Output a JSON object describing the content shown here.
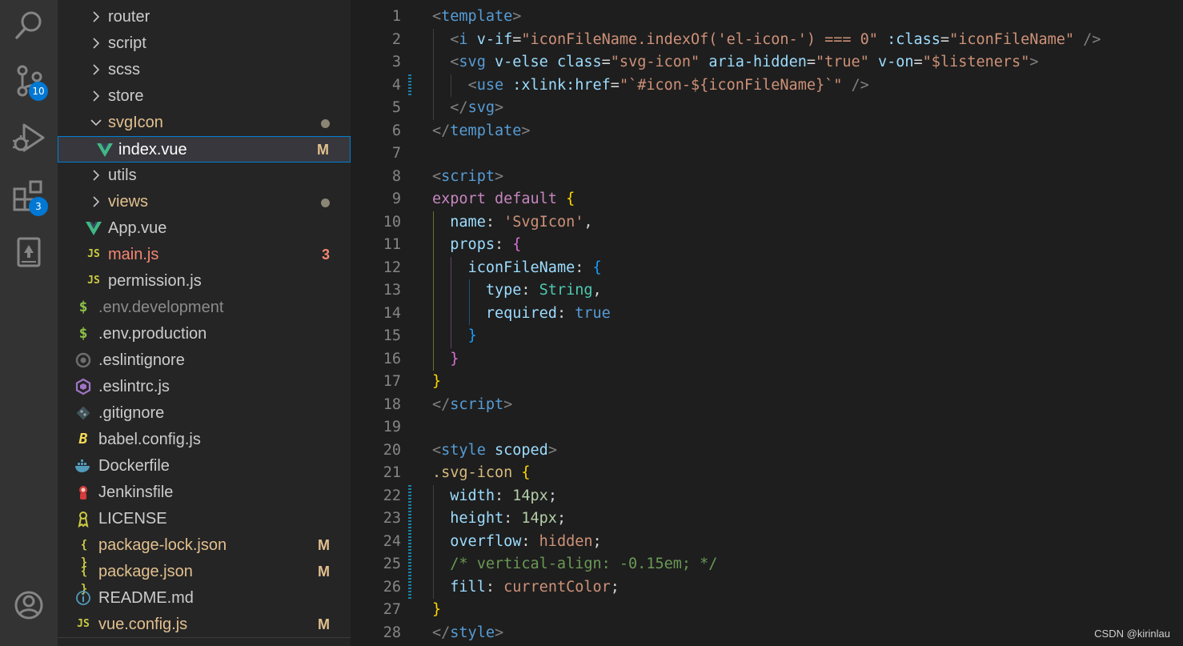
{
  "activity_bar": {
    "source_control_badge": "10",
    "extensions_badge": "3"
  },
  "explorer": {
    "items": [
      {
        "label": "router",
        "kind": "folder",
        "icon": "chevron-right-icon"
      },
      {
        "label": "script",
        "kind": "folder",
        "icon": "chevron-right-icon"
      },
      {
        "label": "scss",
        "kind": "folder",
        "icon": "chevron-right-icon"
      },
      {
        "label": "store",
        "kind": "folder",
        "icon": "chevron-right-icon"
      },
      {
        "label": "svgIcon",
        "kind": "folder-open",
        "icon": "chevron-down-icon",
        "decoration": "dot"
      },
      {
        "label": "index.vue",
        "kind": "vue",
        "icon": "vue-icon",
        "decoration": "M",
        "selected": true
      },
      {
        "label": "utils",
        "kind": "folder",
        "icon": "chevron-right-icon"
      },
      {
        "label": "views",
        "kind": "folder",
        "icon": "chevron-right-icon",
        "decoration": "dot"
      },
      {
        "label": "App.vue",
        "kind": "vue",
        "icon": "vue-icon"
      },
      {
        "label": "main.js",
        "kind": "js",
        "icon": "js-icon",
        "decoration": "3",
        "error": true
      },
      {
        "label": "permission.js",
        "kind": "js",
        "icon": "js-icon"
      },
      {
        "label": ".env.development",
        "kind": "env",
        "icon": "dollar-icon",
        "dim": true
      },
      {
        "label": ".env.production",
        "kind": "env",
        "icon": "dollar-icon"
      },
      {
        "label": ".eslintignore",
        "kind": "eslintignore",
        "icon": "eslint-ignore-icon"
      },
      {
        "label": ".eslintrc.js",
        "kind": "eslint",
        "icon": "eslint-icon"
      },
      {
        "label": ".gitignore",
        "kind": "git",
        "icon": "git-icon"
      },
      {
        "label": "babel.config.js",
        "kind": "babel",
        "icon": "babel-icon"
      },
      {
        "label": "Dockerfile",
        "kind": "docker",
        "icon": "docker-icon"
      },
      {
        "label": "Jenkinsfile",
        "kind": "jenkins",
        "icon": "jenkins-icon"
      },
      {
        "label": "LICENSE",
        "kind": "license",
        "icon": "license-icon"
      },
      {
        "label": "package-lock.json",
        "kind": "json",
        "icon": "json-icon",
        "decoration": "M",
        "modified": true
      },
      {
        "label": "package.json",
        "kind": "json",
        "icon": "json-icon",
        "decoration": "M",
        "modified": true
      },
      {
        "label": "README.md",
        "kind": "info",
        "icon": "info-icon"
      },
      {
        "label": "vue.config.js",
        "kind": "js",
        "icon": "js-icon",
        "decoration": "M",
        "modified": true
      }
    ],
    "glyphs": {
      "js": "JS",
      "env": "$",
      "json": "{ }",
      "babel": "B",
      "info": "i"
    }
  },
  "editor": {
    "lines": [
      {
        "n": "1",
        "tokens": [
          [
            "<",
            "t-punc"
          ],
          [
            "template",
            "t-tag"
          ],
          [
            ">",
            "t-punc"
          ]
        ]
      },
      {
        "n": "2",
        "tokens": [
          [
            "  ",
            "t-default"
          ],
          [
            "<",
            "t-punc"
          ],
          [
            "i",
            "t-tag"
          ],
          [
            " ",
            "t-default"
          ],
          [
            "v-if",
            "t-attr"
          ],
          [
            "=",
            "t-default"
          ],
          [
            "\"iconFileName.indexOf(",
            "t-str"
          ],
          [
            "'el-icon-'",
            "t-str"
          ],
          [
            ") === 0\"",
            "t-str"
          ],
          [
            " ",
            "t-default"
          ],
          [
            ":class",
            "t-attr"
          ],
          [
            "=",
            "t-default"
          ],
          [
            "\"iconFileName\"",
            "t-str"
          ],
          [
            " ",
            "t-default"
          ],
          [
            "/>",
            "t-punc"
          ]
        ]
      },
      {
        "n": "3",
        "tokens": [
          [
            "  ",
            "t-default"
          ],
          [
            "<",
            "t-punc"
          ],
          [
            "svg",
            "t-tag"
          ],
          [
            " ",
            "t-default"
          ],
          [
            "v-else",
            "t-attr"
          ],
          [
            " ",
            "t-default"
          ],
          [
            "class",
            "t-attr"
          ],
          [
            "=",
            "t-default"
          ],
          [
            "\"svg-icon\"",
            "t-str"
          ],
          [
            " ",
            "t-default"
          ],
          [
            "aria-hidden",
            "t-attr"
          ],
          [
            "=",
            "t-default"
          ],
          [
            "\"true\"",
            "t-str"
          ],
          [
            " ",
            "t-default"
          ],
          [
            "v-on",
            "t-attr"
          ],
          [
            "=",
            "t-default"
          ],
          [
            "\"$listeners\"",
            "t-str"
          ],
          [
            ">",
            "t-punc"
          ]
        ]
      },
      {
        "n": "4",
        "tokens": [
          [
            "    ",
            "t-default"
          ],
          [
            "<",
            "t-punc"
          ],
          [
            "use",
            "t-tag"
          ],
          [
            " ",
            "t-default"
          ],
          [
            ":xlink:href",
            "t-attr"
          ],
          [
            "=",
            "t-default"
          ],
          [
            "\"`#icon-${iconFileName}`\"",
            "t-str"
          ],
          [
            " ",
            "t-default"
          ],
          [
            "/>",
            "t-punc"
          ]
        ]
      },
      {
        "n": "5",
        "tokens": [
          [
            "  ",
            "t-default"
          ],
          [
            "</",
            "t-punc"
          ],
          [
            "svg",
            "t-tag"
          ],
          [
            ">",
            "t-punc"
          ]
        ]
      },
      {
        "n": "6",
        "tokens": [
          [
            "</",
            "t-punc"
          ],
          [
            "template",
            "t-tag"
          ],
          [
            ">",
            "t-punc"
          ]
        ]
      },
      {
        "n": "7",
        "tokens": []
      },
      {
        "n": "8",
        "tokens": [
          [
            "<",
            "t-punc"
          ],
          [
            "script",
            "t-tag"
          ],
          [
            ">",
            "t-punc"
          ]
        ]
      },
      {
        "n": "9",
        "tokens": [
          [
            "export",
            "t-kw"
          ],
          [
            " ",
            "t-default"
          ],
          [
            "default",
            "t-kw"
          ],
          [
            " ",
            "t-default"
          ],
          [
            "{",
            "t-b1"
          ]
        ]
      },
      {
        "n": "10",
        "tokens": [
          [
            "  ",
            "t-default"
          ],
          [
            "name",
            "t-prop"
          ],
          [
            ": ",
            "t-default"
          ],
          [
            "'SvgIcon'",
            "t-str"
          ],
          [
            ",",
            "t-default"
          ]
        ]
      },
      {
        "n": "11",
        "tokens": [
          [
            "  ",
            "t-default"
          ],
          [
            "props",
            "t-prop"
          ],
          [
            ": ",
            "t-default"
          ],
          [
            "{",
            "t-b2"
          ]
        ]
      },
      {
        "n": "12",
        "tokens": [
          [
            "    ",
            "t-default"
          ],
          [
            "iconFileName",
            "t-prop"
          ],
          [
            ": ",
            "t-default"
          ],
          [
            "{",
            "t-b3"
          ]
        ]
      },
      {
        "n": "13",
        "tokens": [
          [
            "      ",
            "t-default"
          ],
          [
            "type",
            "t-prop"
          ],
          [
            ": ",
            "t-default"
          ],
          [
            "String",
            "t-type"
          ],
          [
            ",",
            "t-default"
          ]
        ]
      },
      {
        "n": "14",
        "tokens": [
          [
            "      ",
            "t-default"
          ],
          [
            "required",
            "t-prop"
          ],
          [
            ": ",
            "t-default"
          ],
          [
            "true",
            "t-bool"
          ]
        ]
      },
      {
        "n": "15",
        "tokens": [
          [
            "    ",
            "t-default"
          ],
          [
            "}",
            "t-b3"
          ]
        ]
      },
      {
        "n": "16",
        "tokens": [
          [
            "  ",
            "t-default"
          ],
          [
            "}",
            "t-b2"
          ]
        ]
      },
      {
        "n": "17",
        "tokens": [
          [
            "}",
            "t-b1"
          ]
        ]
      },
      {
        "n": "18",
        "tokens": [
          [
            "</",
            "t-punc"
          ],
          [
            "script",
            "t-tag"
          ],
          [
            ">",
            "t-punc"
          ]
        ]
      },
      {
        "n": "19",
        "tokens": []
      },
      {
        "n": "20",
        "tokens": [
          [
            "<",
            "t-punc"
          ],
          [
            "style",
            "t-tag"
          ],
          [
            " ",
            "t-default"
          ],
          [
            "scoped",
            "t-attr"
          ],
          [
            ">",
            "t-punc"
          ]
        ]
      },
      {
        "n": "21",
        "tokens": [
          [
            ".svg-icon",
            "t-cls"
          ],
          [
            " ",
            "t-default"
          ],
          [
            "{",
            "t-b1"
          ]
        ]
      },
      {
        "n": "22",
        "tokens": [
          [
            "  ",
            "t-default"
          ],
          [
            "width",
            "t-prop"
          ],
          [
            ": ",
            "t-default"
          ],
          [
            "14px",
            "t-num"
          ],
          [
            ";",
            "t-default"
          ]
        ]
      },
      {
        "n": "23",
        "tokens": [
          [
            "  ",
            "t-default"
          ],
          [
            "height",
            "t-prop"
          ],
          [
            ": ",
            "t-default"
          ],
          [
            "14px",
            "t-num"
          ],
          [
            ";",
            "t-default"
          ]
        ]
      },
      {
        "n": "24",
        "tokens": [
          [
            "  ",
            "t-default"
          ],
          [
            "overflow",
            "t-prop"
          ],
          [
            ": ",
            "t-default"
          ],
          [
            "hidden",
            "t-str"
          ],
          [
            ";",
            "t-default"
          ]
        ]
      },
      {
        "n": "25",
        "tokens": [
          [
            "  ",
            "t-default"
          ],
          [
            "/* vertical-align: -0.15em; */",
            "t-com"
          ]
        ]
      },
      {
        "n": "26",
        "tokens": [
          [
            "  ",
            "t-default"
          ],
          [
            "fill",
            "t-prop"
          ],
          [
            ": ",
            "t-default"
          ],
          [
            "currentColor",
            "t-str"
          ],
          [
            ";",
            "t-default"
          ]
        ]
      },
      {
        "n": "27",
        "tokens": [
          [
            "}",
            "t-b1"
          ]
        ]
      },
      {
        "n": "28",
        "tokens": [
          [
            "</",
            "t-punc"
          ],
          [
            "style",
            "t-tag"
          ],
          [
            ">",
            "t-punc"
          ]
        ]
      }
    ],
    "modified_lines": [
      "4",
      "22",
      "23",
      "24",
      "25",
      "26"
    ]
  },
  "watermark": "CSDN @kirinlau",
  "colors": {
    "activity_bar": "#333333",
    "sidebar": "#252526",
    "editor_bg": "#1e1e1e",
    "selection_border": "#007fd4",
    "badge": "#0078d4",
    "modified": "#e2c08d",
    "error": "#f48771",
    "vue": "#41b883",
    "js": "#cbcb41"
  }
}
